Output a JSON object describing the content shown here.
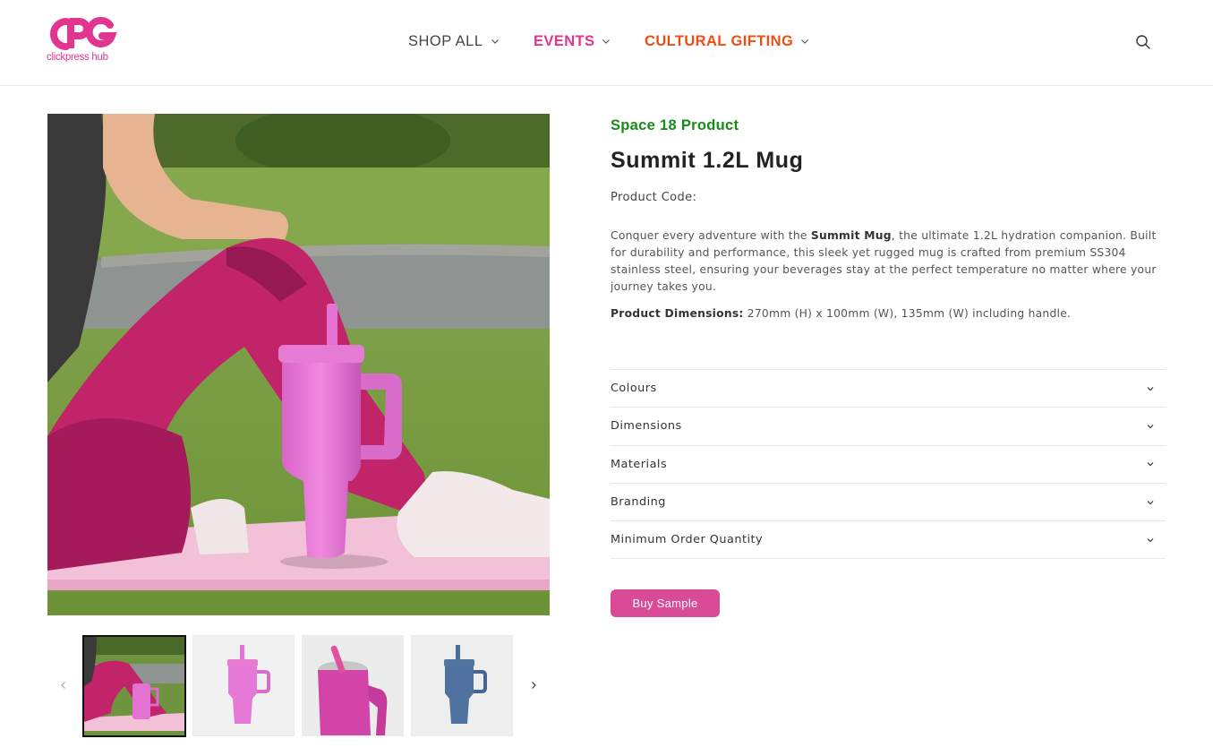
{
  "brand": {
    "logo_mark": "CPG",
    "logo_sub": "clickpress hub",
    "primary_color": "#e2358f",
    "accent_orange": "#ef4d13"
  },
  "nav": {
    "items": [
      {
        "label": "SHOP ALL",
        "icon": "chevron-down-icon"
      },
      {
        "label": "EVENTS",
        "icon": "chevron-down-icon"
      },
      {
        "label": "CULTURAL GIFTING",
        "icon": "chevron-down-icon"
      }
    ],
    "search_icon": "search-icon"
  },
  "gallery": {
    "main_image": "woman seated on pink yoga mat with pink mug on grass",
    "thumbnails": [
      {
        "label": "lifestyle photo",
        "active": true
      },
      {
        "label": "pink mug front"
      },
      {
        "label": "pink mug close-up"
      },
      {
        "label": "blue mug"
      }
    ],
    "prev_icon": "chevron-left-icon",
    "next_icon": "chevron-right-icon"
  },
  "product": {
    "vendor": "Space 18 Product",
    "title": "Summit 1.2L Mug",
    "code_label": "Product Code:",
    "desc_pre": "Conquer every adventure with the ",
    "desc_bold": "Summit Mug",
    "desc_post": ", the ultimate 1.2L hydration companion. Built for durability and performance, this sleek yet rugged mug is crafted from premium SS304 stainless steel, ensuring your beverages stay at the perfect temperature no matter where your journey takes you.",
    "dims_label": "Product Dimensions:",
    "dims_value": " 270mm (H) x 100mm (W), 135mm (W) including handle.",
    "vendor_color": "#1a8a1a"
  },
  "accordion": [
    {
      "label": "Colours"
    },
    {
      "label": "Dimensions"
    },
    {
      "label": "Materials"
    },
    {
      "label": "Branding"
    },
    {
      "label": "Minimum Order Quantity"
    }
  ],
  "buy": {
    "label": "Buy Sample",
    "color": "#d94b97"
  }
}
